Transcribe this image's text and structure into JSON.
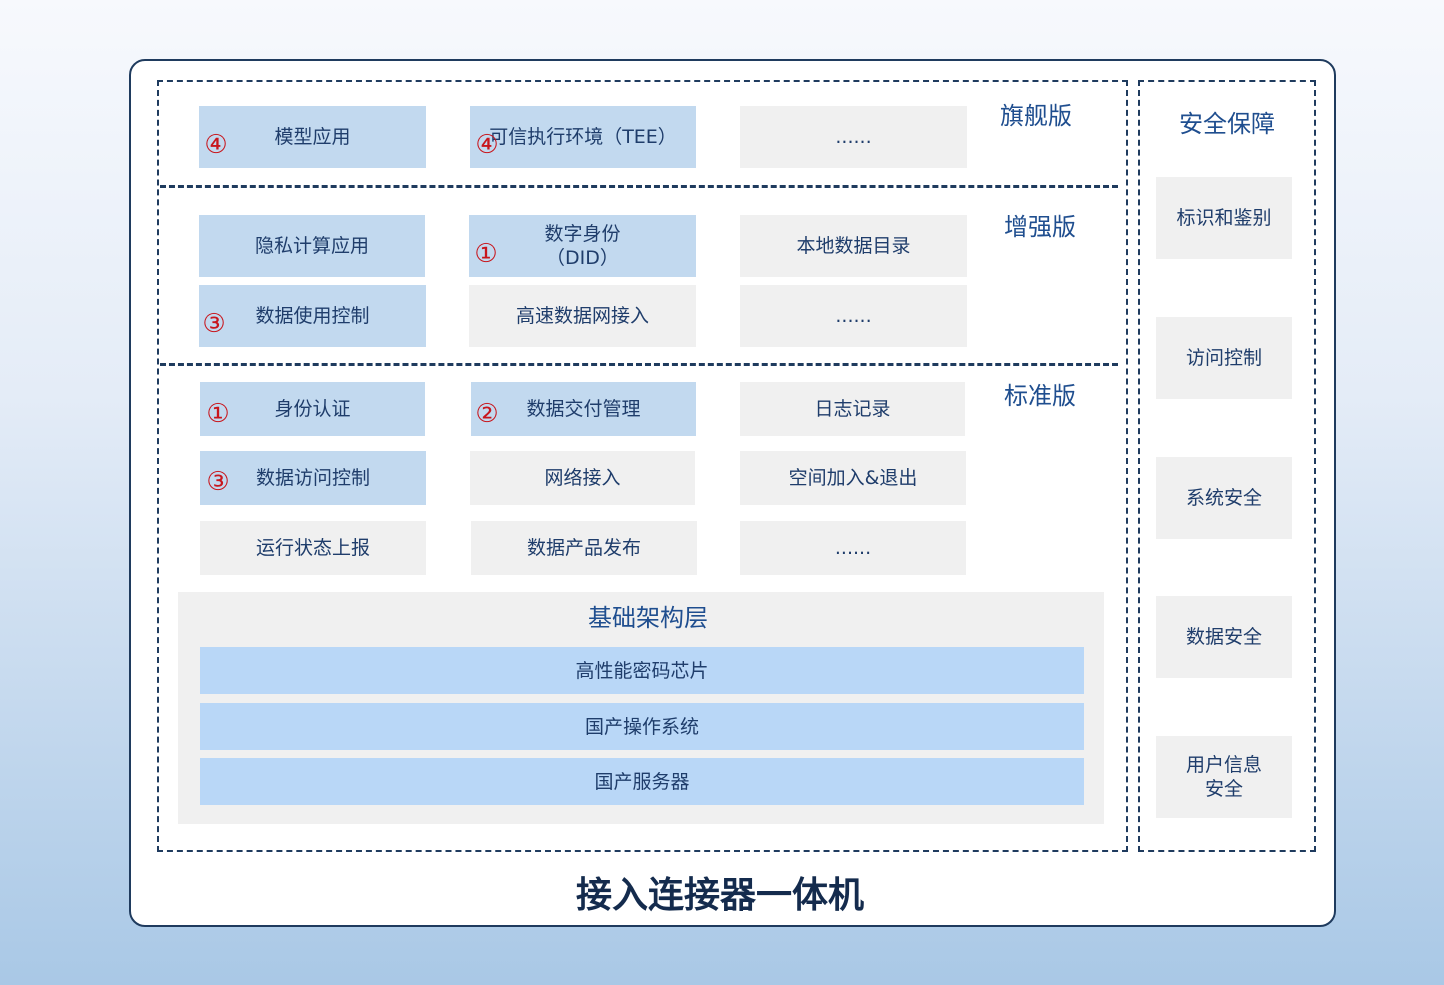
{
  "title": "接入连接器一体机",
  "editions": {
    "flagship": {
      "label": "旗舰版",
      "items": [
        {
          "text": "模型应用",
          "mark": "④"
        },
        {
          "text": "可信执行环境（TEE）",
          "mark": "④"
        },
        {
          "text": "......"
        }
      ]
    },
    "enhanced": {
      "label": "增强版",
      "items": [
        {
          "text": "隐私计算应用"
        },
        {
          "text": "数字身份\n（DID）",
          "mark": "①"
        },
        {
          "text": "本地数据目录"
        },
        {
          "text": "数据使用控制",
          "mark": "③"
        },
        {
          "text": "高速数据网接入"
        },
        {
          "text": "......"
        }
      ]
    },
    "standard": {
      "label": "标准版",
      "items": [
        {
          "text": "身份认证",
          "mark": "①"
        },
        {
          "text": "数据交付管理",
          "mark": "②"
        },
        {
          "text": "日志记录"
        },
        {
          "text": "数据访问控制",
          "mark": "③"
        },
        {
          "text": "网络接入"
        },
        {
          "text": "空间加入&退出"
        },
        {
          "text": "运行状态上报"
        },
        {
          "text": "数据产品发布"
        },
        {
          "text": "......"
        }
      ]
    }
  },
  "infrastructure": {
    "title": "基础架构层",
    "layers": [
      "高性能密码芯片",
      "国产操作系统",
      "国产服务器"
    ]
  },
  "security": {
    "title": "安全保障",
    "items": [
      "标识和鉴别",
      "访问控制",
      "系统安全",
      "数据安全",
      "用户信息\n安全"
    ]
  },
  "colors": {
    "highlight_fill": "#c2d9ef",
    "plain_fill": "#f0f0f0",
    "infra_bar_fill": "#b9d7f7",
    "text": "#1f3d6b",
    "border": "#1f3b5e",
    "marker": "#c8161d"
  }
}
